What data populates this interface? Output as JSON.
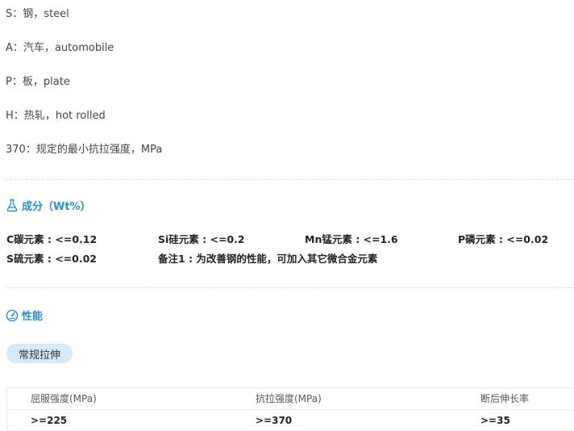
{
  "definitions": [
    {
      "code": "S",
      "zh": "钢",
      "en": "steel"
    },
    {
      "code": "A",
      "zh": "汽车",
      "en": "automobile"
    },
    {
      "code": "P",
      "zh": "板",
      "en": "plate"
    },
    {
      "code": "H",
      "zh": "热轧",
      "en": "hot rolled"
    },
    {
      "code": "370",
      "zh": "规定的最小抗拉强度",
      "en": "MPa"
    }
  ],
  "composition": {
    "title": "成分（Wt%）",
    "icon": "flask-icon",
    "items": [
      "C碳元素 : <=0.12",
      "Si硅元素 : <=0.2",
      "Mn锰元素 : <=1.6",
      "P磷元素 : <=0.02",
      "S硫元素 : <=0.02",
      "备注1 : 为改善钢的性能，可加入其它微合金元素"
    ]
  },
  "performance": {
    "title": "性能",
    "icon": "gauge-icon",
    "tab_label": "常规拉伸",
    "table": {
      "headers": [
        "屈服强度(MPa)",
        "抗拉强度(MPa)",
        "断后伸长率"
      ],
      "rows": [
        [
          ">=225",
          ">=370",
          ">=35"
        ]
      ]
    }
  },
  "colors": {
    "accent": "#2a8fd0",
    "pill_bg": "#d4eaf8"
  }
}
